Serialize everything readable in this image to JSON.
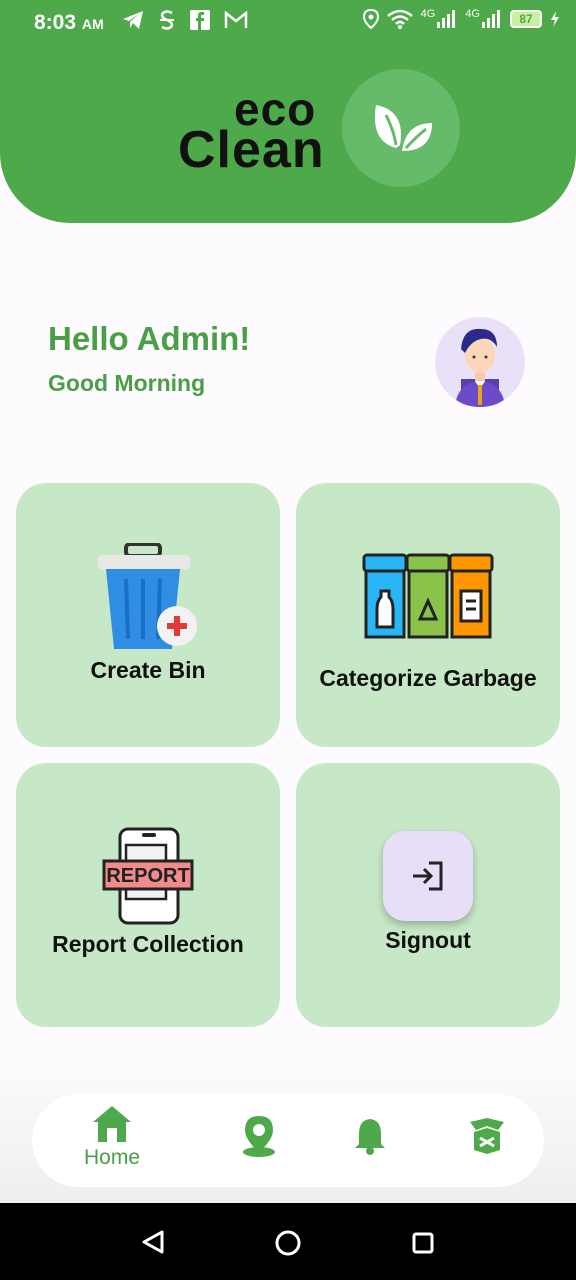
{
  "status_bar": {
    "time": "8:03",
    "ampm": "AM",
    "battery": "87",
    "network_1": "4G",
    "network_2": "4G"
  },
  "logo": {
    "line1": "eco",
    "line2": "Clean"
  },
  "greeting": {
    "title": "Hello Admin!",
    "subtitle": "Good Morning"
  },
  "cards": [
    {
      "label": "Create Bin",
      "icon": "trash-bin-add-icon"
    },
    {
      "label": "Categorize Garbage",
      "icon": "recycle-bins-icon"
    },
    {
      "label": "Report Collection",
      "icon": "report-icon"
    },
    {
      "label": "Signout",
      "icon": "signout-icon"
    }
  ],
  "bottom_nav": {
    "home_label": "Home",
    "items": [
      "home-icon",
      "map-pin-icon",
      "bell-icon",
      "box-icon"
    ]
  },
  "colors": {
    "primary": "#4ea94a",
    "card_bg": "#c6e8c6",
    "accent_text": "#4a9e47"
  }
}
